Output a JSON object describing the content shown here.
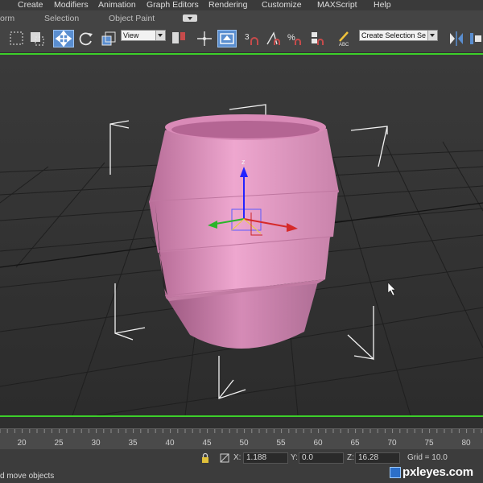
{
  "menubar": {
    "items": [
      "Create",
      "Modifiers",
      "Animation",
      "Graph Editors",
      "Rendering",
      "Customize",
      "MAXScript",
      "Help"
    ]
  },
  "ribbon": {
    "tabs": [
      "orm",
      "Selection",
      "Object Paint"
    ]
  },
  "toolbar": {
    "reference_coord": "View",
    "named_selection_placeholder": "Create Selection Se",
    "accent_color": "#5a8ed0"
  },
  "viewport": {
    "border_color": "#3ccf2a",
    "object_color": "#e59bc4",
    "gizmo_axis_label": "z"
  },
  "timeline": {
    "ticks": [
      "20",
      "25",
      "30",
      "35",
      "40",
      "45",
      "50",
      "55",
      "60",
      "65",
      "70",
      "75",
      "80"
    ]
  },
  "statusbar": {
    "x_label": "X:",
    "x_value": "1.188",
    "y_label": "Y:",
    "y_value": "0.0",
    "z_label": "Z:",
    "z_value": "16.28",
    "grid_label": "Grid = 10.0",
    "prompt": "d move objects"
  },
  "watermark": {
    "text": "pxleyes.com"
  }
}
